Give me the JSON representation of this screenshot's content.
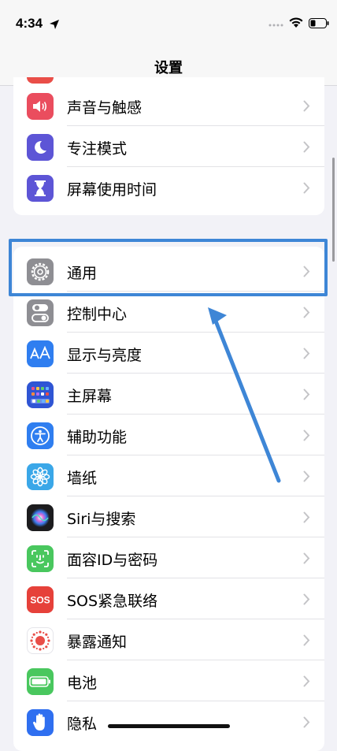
{
  "status_bar": {
    "time": "4:34"
  },
  "nav": {
    "title": "设置"
  },
  "group1": [
    {
      "label": "声音与触感",
      "icon": "speaker-icon",
      "color": "#ea4d5e"
    },
    {
      "label": "专注模式",
      "icon": "moon-icon",
      "color": "#5d55d6"
    },
    {
      "label": "屏幕使用时间",
      "icon": "hourglass-icon",
      "color": "#5d55d6"
    }
  ],
  "group2": [
    {
      "label": "通用",
      "icon": "gear-icon",
      "color": "#8e8e93"
    },
    {
      "label": "控制中心",
      "icon": "toggles-icon",
      "color": "#8e8e93"
    },
    {
      "label": "显示与亮度",
      "icon": "text-size-icon",
      "color": "#2f7ef0"
    },
    {
      "label": "主屏幕",
      "icon": "home-grid-icon",
      "color": "#2f55d4"
    },
    {
      "label": "辅助功能",
      "icon": "accessibility-icon",
      "color": "#2f7ef0"
    },
    {
      "label": "墙纸",
      "icon": "flower-icon",
      "color": "#3aa7e8"
    },
    {
      "label": "Siri与搜索",
      "icon": "siri-icon",
      "color": "#1c1c1e"
    },
    {
      "label": "面容ID与密码",
      "icon": "face-id-icon",
      "color": "#49c75e"
    },
    {
      "label": "SOS紧急联络",
      "icon": "sos-icon",
      "color": "#e6413a"
    },
    {
      "label": "暴露通知",
      "icon": "exposure-icon",
      "color": "#ffffff"
    },
    {
      "label": "电池",
      "icon": "battery-icon",
      "color": "#49c75e"
    },
    {
      "label": "隐私",
      "icon": "hand-icon",
      "color": "#2f6ff0"
    }
  ],
  "annotation": {
    "highlight_color": "#3e86d6"
  }
}
